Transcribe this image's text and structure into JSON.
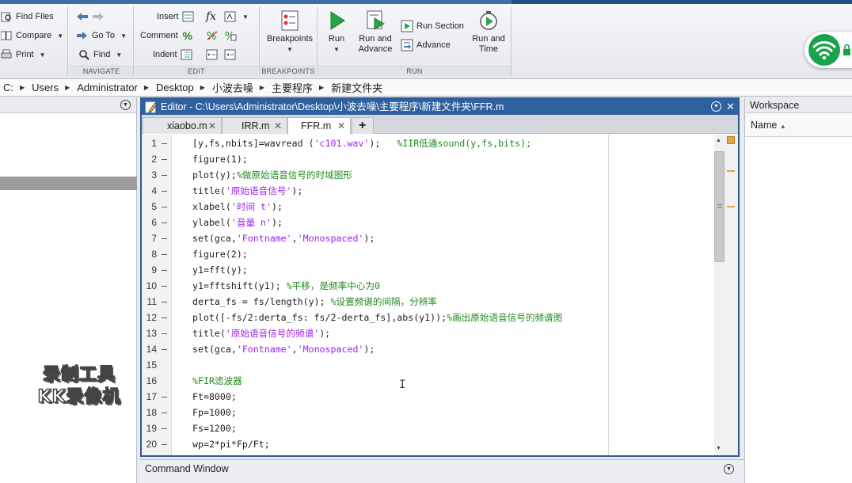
{
  "ribbon": {
    "file_group": {
      "find_files": "Find Files",
      "compare": "Compare",
      "print": "Print"
    },
    "navigate_group": {
      "go_to": "Go To",
      "find": "Find",
      "label": "NAVIGATE"
    },
    "edit_group": {
      "insert": "Insert",
      "comment": "Comment",
      "indent": "Indent",
      "fx": "fx",
      "pct1": "%",
      "label": "EDIT"
    },
    "breakpoints_group": {
      "breakpoints": "Breakpoints",
      "label": "BREAKPOINTS"
    },
    "run_group": {
      "run": "Run",
      "run_and_advance_1": "Run and",
      "run_and_advance_2": "Advance",
      "run_section": "Run Section",
      "advance": "Advance",
      "run_and_time_1": "Run and",
      "run_and_time_2": "Time",
      "label": "RUN"
    }
  },
  "address": {
    "root": "C:",
    "crumbs": [
      "Users",
      "Administrator",
      "Desktop",
      "小波去噪",
      "主要程序",
      "新建文件夹"
    ]
  },
  "editor": {
    "title": "Editor - C:\\Users\\Administrator\\Desktop\\小波去噪\\主要程序\\新建文件夹\\FFR.m",
    "tabs": [
      {
        "label": "xiaobo.m",
        "active": false
      },
      {
        "label": "IRR.m",
        "active": false
      },
      {
        "label": "FFR.m",
        "active": true
      }
    ],
    "add_tab": "+",
    "lines": [
      {
        "n": "1",
        "dash": "–",
        "code": "[y,fs,nbits]=wavread ('c101.wav');   %IIR低通sound(y,fs,bits);"
      },
      {
        "n": "2",
        "dash": "–",
        "code": "figure(1);"
      },
      {
        "n": "3",
        "dash": "–",
        "code": "plot(y);%做原始语音信号的时域图形"
      },
      {
        "n": "4",
        "dash": "–",
        "code": "title('原始语音信号');"
      },
      {
        "n": "5",
        "dash": "–",
        "code": "xlabel('时间 t');"
      },
      {
        "n": "6",
        "dash": "–",
        "code": "ylabel('音量 n');"
      },
      {
        "n": "7",
        "dash": "–",
        "code": "set(gca,'Fontname','Monospaced');"
      },
      {
        "n": "8",
        "dash": "–",
        "code": "figure(2);"
      },
      {
        "n": "9",
        "dash": "–",
        "code": "y1=fft(y);"
      },
      {
        "n": "10",
        "dash": "–",
        "code": "y1=fftshift(y1); %平移，是频率中心为0"
      },
      {
        "n": "11",
        "dash": "–",
        "code": "derta_fs = fs/length(y); %设置频谱的间隔，分辨率"
      },
      {
        "n": "12",
        "dash": "–",
        "code": "plot([-fs/2:derta_fs: fs/2-derta_fs],abs(y1));%画出原始语音信号的频谱图"
      },
      {
        "n": "13",
        "dash": "–",
        "code": "title('原始语音信号的频谱');"
      },
      {
        "n": "14",
        "dash": "–",
        "code": "set(gca,'Fontname','Monospaced');"
      },
      {
        "n": "15",
        "dash": "",
        "code": ""
      },
      {
        "n": "16",
        "dash": "",
        "code": "%FIR滤波器"
      },
      {
        "n": "17",
        "dash": "–",
        "code": "Ft=8000;"
      },
      {
        "n": "18",
        "dash": "–",
        "code": "Fp=1000;"
      },
      {
        "n": "19",
        "dash": "–",
        "code": "Fs=1200;"
      },
      {
        "n": "20",
        "dash": "–",
        "code": "wp=2*pi*Fp/Ft;"
      }
    ]
  },
  "command_window": {
    "title": "Command Window"
  },
  "workspace": {
    "title": "Workspace",
    "name_col": "Name"
  },
  "watermark": {
    "line1": "录制工具",
    "line2": "KK录像机"
  },
  "colors": {
    "accent": "#2f609f",
    "comment": "#228b22",
    "string": "#a020f0",
    "wifi": "#1aa34a"
  }
}
